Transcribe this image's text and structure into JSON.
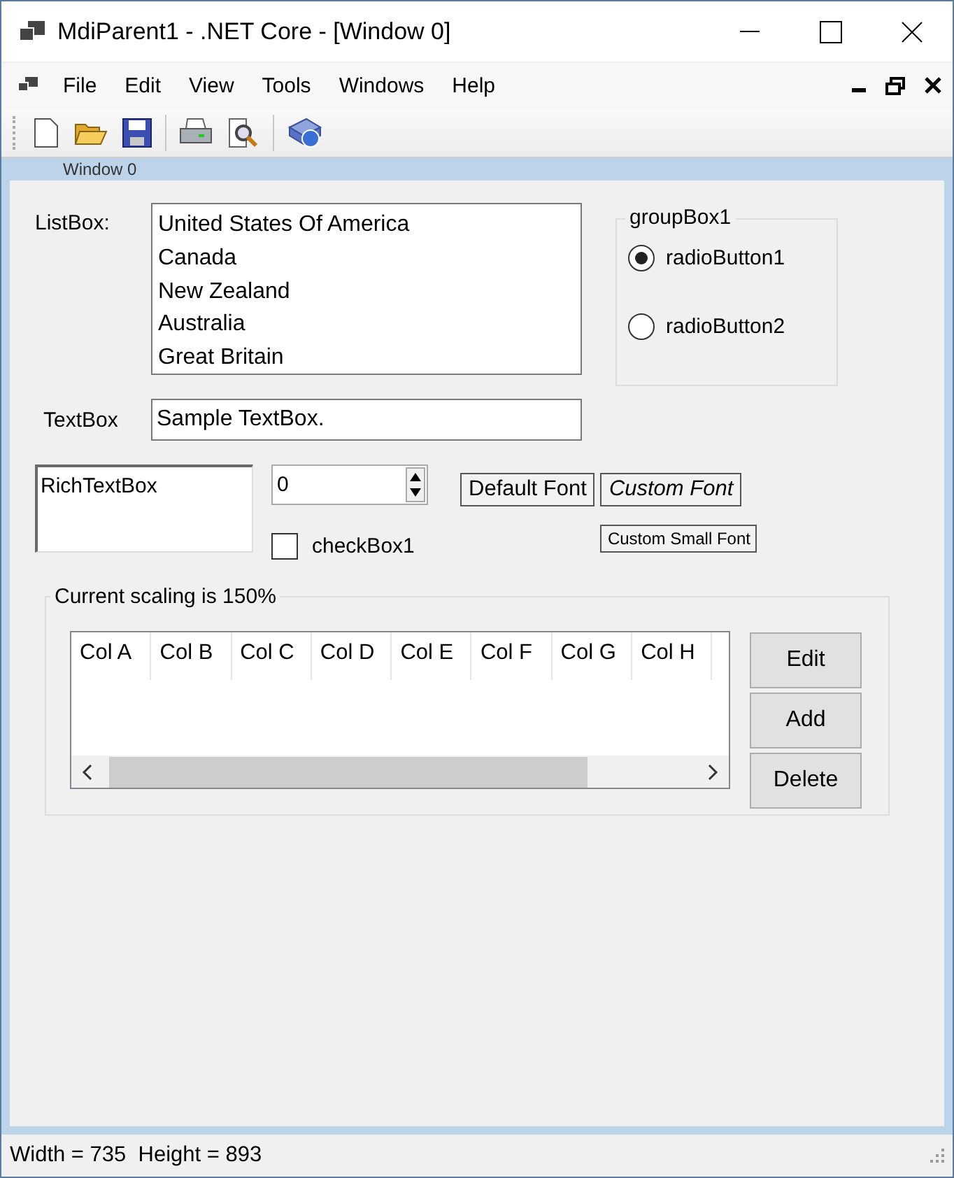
{
  "window": {
    "title": "MdiParent1 - .NET Core - [Window 0]"
  },
  "menu": [
    "File",
    "Edit",
    "View",
    "Tools",
    "Windows",
    "Help"
  ],
  "toolbar": [
    {
      "kind": "new"
    },
    {
      "kind": "open"
    },
    {
      "kind": "save"
    },
    {
      "kind": "sep"
    },
    {
      "kind": "print"
    },
    {
      "kind": "preview"
    },
    {
      "kind": "sep"
    },
    {
      "kind": "help"
    }
  ],
  "child_window": {
    "title": "Window 0"
  },
  "listbox": {
    "label": "ListBox:",
    "items": [
      "United States Of America",
      "Canada",
      "New Zealand",
      "Australia",
      "Great Britain"
    ]
  },
  "group_box": {
    "title": "groupBox1",
    "radios": [
      {
        "label": "radioButton1",
        "selected": true
      },
      {
        "label": "radioButton2",
        "selected": false
      }
    ]
  },
  "textbox": {
    "label": "TextBox",
    "value": "Sample TextBox."
  },
  "rich_textbox": {
    "value": "RichTextBox"
  },
  "numeric": {
    "value": "0"
  },
  "checkbox": {
    "label": "checkBox1",
    "checked": false
  },
  "font_buttons": [
    {
      "label": "Default Font",
      "kind": "default"
    },
    {
      "label": "Custom Font",
      "kind": "italic"
    },
    {
      "label": "Custom Small Font",
      "kind": "small"
    }
  ],
  "scaling_group": {
    "title": "Current scaling is 150%",
    "columns": [
      "Col A",
      "Col B",
      "Col C",
      "Col D",
      "Col E",
      "Col F",
      "Col G",
      "Col H"
    ],
    "buttons": [
      "Edit",
      "Add",
      "Delete"
    ]
  },
  "status_bar": "Width = 735  Height = 893"
}
